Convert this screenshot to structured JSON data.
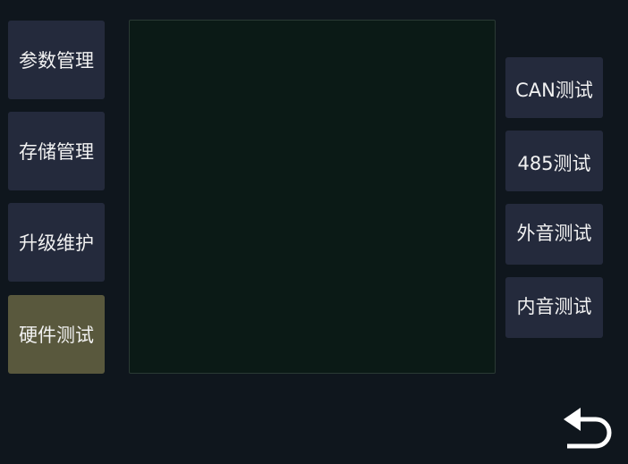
{
  "left_menu": {
    "items": [
      {
        "label": "参数管理"
      },
      {
        "label": "存储管理"
      },
      {
        "label": "升级维护"
      },
      {
        "label": "硬件测试",
        "active": true
      }
    ]
  },
  "right_menu": {
    "items": [
      {
        "label": "CAN测试"
      },
      {
        "label": "485测试"
      },
      {
        "label": "外音测试"
      },
      {
        "label": "内音测试"
      }
    ]
  },
  "back_button": {
    "icon": "back-arrow-icon"
  },
  "colors": {
    "background": "#0f161d",
    "button": "#242a3c",
    "active_button": "#59583d",
    "panel": "#0b1a16"
  }
}
